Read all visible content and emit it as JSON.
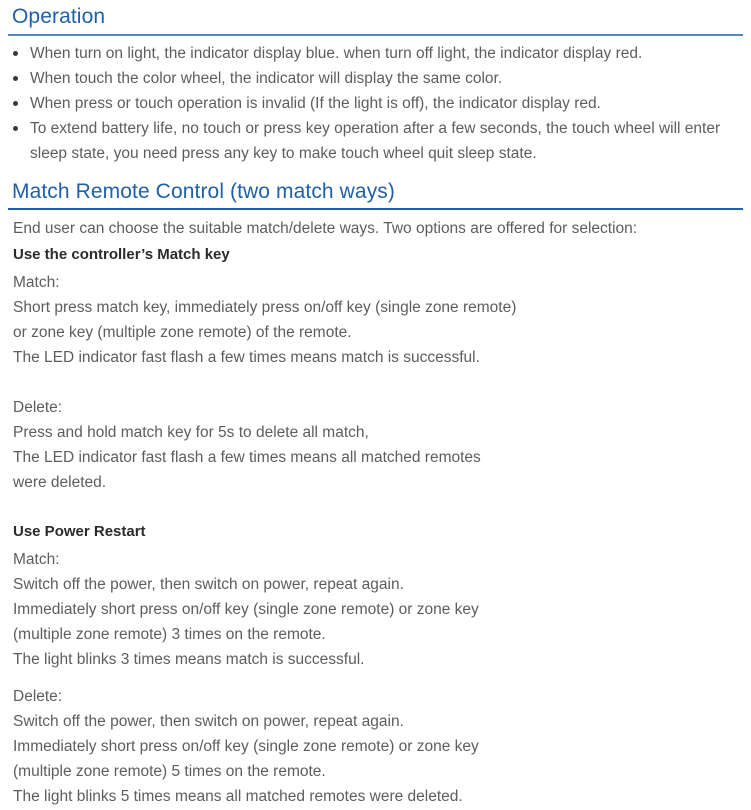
{
  "colors": {
    "heading_blue": "#1f60a8",
    "rule_steel_blue": "#5489bc",
    "rule_dark_blue": "#1f60a8",
    "body_gray": "#5d5d5d",
    "subheading_dark": "#2b2b2b"
  },
  "operation": {
    "heading": "Operation",
    "bullets": [
      "When turn on light, the indicator display blue. when turn off light, the indicator display red.",
      "When touch the color wheel, the indicator will display the same color.",
      "When press or touch operation is invalid (If the light is off), the indicator display red.",
      "To extend battery life, no touch or press key operation after a few seconds, the touch wheel will enter sleep state, you need press any key to make touch  wheel quit sleep state."
    ]
  },
  "match_remote": {
    "heading": "Match Remote Control (two match ways)",
    "intro": "End user can choose the suitable match/delete ways. Two options are offered for selection:",
    "method_one": {
      "title": "Use the controller’s Match key",
      "match_label": "Match:",
      "match_lines": [
        "Short press match key, immediately press on/off key (single zone remote)",
        "or zone key (multiple zone remote) of the remote.",
        "The LED indicator fast flash a few times means match is successful."
      ],
      "delete_label": "Delete:",
      "delete_lines": [
        "Press and hold match key for 5s to delete all match,",
        "The LED indicator fast flash a few times means all matched remotes",
        "were deleted."
      ]
    },
    "method_two": {
      "title": "Use Power Restart",
      "match_label": "Match:",
      "match_lines": [
        "Switch off the power, then switch on power, repeat again.",
        "Immediately short press on/off key (single zone remote) or zone key",
        "(multiple zone remote) 3 times on the remote.",
        "The light blinks 3 times means match is successful."
      ],
      "delete_label": "Delete:",
      "delete_lines": [
        "Switch off the power, then switch on power, repeat again.",
        "Immediately short press on/off key (single zone remote) or zone key",
        "(multiple zone remote) 5 times on the remote.",
        "The light blinks 5 times means all matched remotes were deleted."
      ]
    }
  }
}
